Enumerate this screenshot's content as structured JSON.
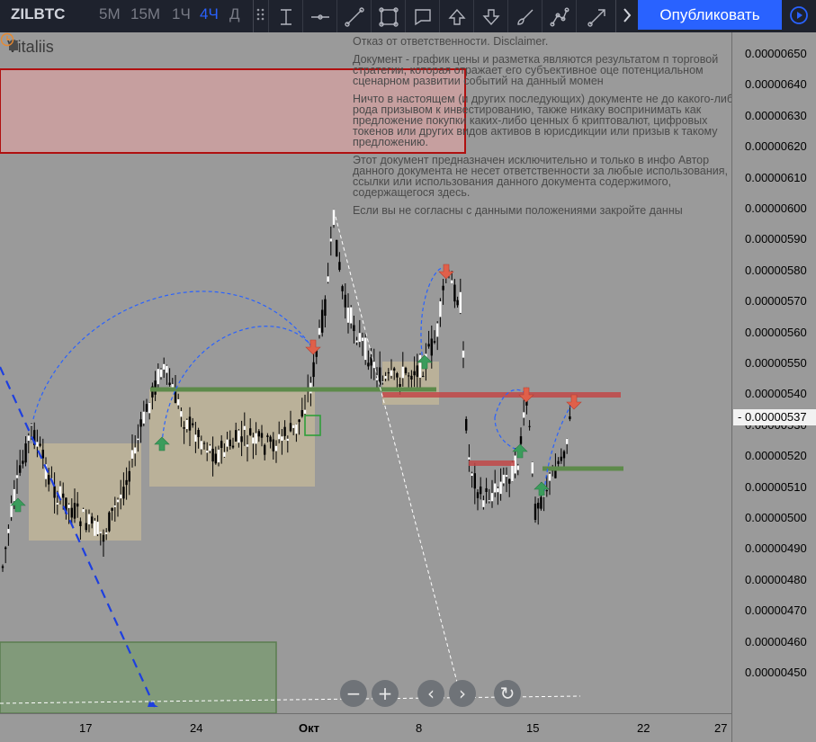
{
  "header": {
    "symbol": "ZILBTC",
    "intervals": [
      {
        "label": "5M",
        "active": false
      },
      {
        "label": "15M",
        "active": false
      },
      {
        "label": "1Ч",
        "active": false
      },
      {
        "label": "4Ч",
        "active": true
      },
      {
        "label": "Д",
        "active": false
      }
    ],
    "drawing_tools": [
      "text-cursor-icon",
      "horizontal-line-icon",
      "trend-line-icon",
      "rectangle-icon",
      "callout-icon",
      "arrow-up-icon",
      "arrow-down-icon",
      "brush-icon",
      "path-icon",
      "arrow-line-icon"
    ],
    "publish_label": "Опубликовать",
    "accent": "#2962ff"
  },
  "chart": {
    "author": "Vitaliis",
    "disclaimer": [
      "Отказ от ответственности. Disclaimer.",
      "Документ - график цены и разметка являются результатом п торговой стратегии, которая отражает его субъективное оце потенциальном сценарном развитии событий на данный момен",
      "Ничто в настоящем (и других последующих) документе не до какого-либо рода призывом к инвестированию, также никаку воспринимать как предложение покупки каких-либо ценных б криптовалют, цифровых токенов или других видов активов в юрисдикции или призыв к такому предложению.",
      "Этот документ предназначен исключительно и только в инфо Автор данного документа не несет ответственности за любые использования, ссылки или использования данного документа содержимого, содержащегося здесь.",
      "Если вы не согласны с данными положениями закройте данны"
    ],
    "price_labels": [
      "0.00000650",
      "0.00000640",
      "0.00000630",
      "0.00000620",
      "0.00000610",
      "0.00000600",
      "0.00000590",
      "0.00000580",
      "0.00000570",
      "0.00000560",
      "0.00000550",
      "0.00000540",
      "0.00000530",
      "0.00000520",
      "0.00000510",
      "0.00000500",
      "0.00000490",
      "0.00000480",
      "0.00000470",
      "0.00000460",
      "0.00000450"
    ],
    "current_price": "0.00000537",
    "time_labels": [
      {
        "label": "17",
        "bold": false
      },
      {
        "label": "24",
        "bold": false
      },
      {
        "label": "Окт",
        "bold": true
      },
      {
        "label": "8",
        "bold": false
      },
      {
        "label": "15",
        "bold": false
      },
      {
        "label": "22",
        "bold": false
      },
      {
        "label": "27",
        "bold": false
      }
    ],
    "nav_buttons": [
      "zoom-out",
      "zoom-in",
      "scroll-left",
      "scroll-right",
      "reset"
    ],
    "colors": {
      "background": "#9a9a9a",
      "up_candle": "#ffffff",
      "down_candle": "#000000",
      "resistance_zone": "#d4a0a0",
      "support_zone": "#7d9a74",
      "accumulation_zone": "#c4b898",
      "green_level": "#5d8a4a",
      "red_level": "#c24848",
      "signal_up": "#3b9c5c",
      "signal_down": "#e0604a"
    }
  }
}
